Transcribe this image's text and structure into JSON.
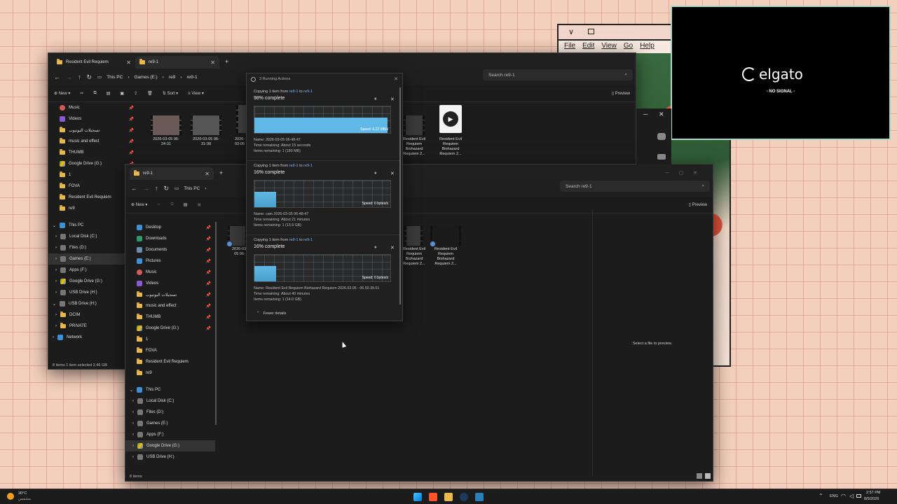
{
  "back_window": {
    "tabs": [
      {
        "label": "Resident Evil Requiem"
      },
      {
        "label": "re9-1"
      }
    ],
    "breadcrumb": [
      "This PC",
      "Games (E:)",
      "re9",
      "re9-1"
    ],
    "toolbar": {
      "new": "New",
      "sort": "Sort",
      "view": "View",
      "preview": "Preview"
    },
    "search_placeholder": "Search re9-1",
    "quick_access": [
      "Music",
      "Videos",
      "تسجيلات اليوتيوب",
      "music and effect",
      "THUMB",
      "Google Drive (G:)",
      "1",
      "FOVA",
      "Resident Evil Requiem",
      "re9"
    ],
    "this_pc": "This PC",
    "drives": [
      "Local Disk (C:)",
      "Files (D:)",
      "Games (E:)",
      "Apps (F:)",
      "Google Drive (G:)",
      "USB Drive (H:)"
    ],
    "usb_label": "USB Drive (H:)",
    "usb_children": [
      "DCIM",
      "PRIVATE"
    ],
    "network": "Network",
    "files": [
      {
        "name": "2026-03-05 06-24-31"
      },
      {
        "name": "2026-03-05 06-31-38"
      },
      {
        "name": "2026-03-05 06-4..."
      },
      {
        "name": "Resident Evil Requiem Biohazard Requiem 2..."
      },
      {
        "name": "Resident Evil Requiem Biohazard Requiem 2..."
      }
    ],
    "status": "8 items   1 item selected  2.46 GB"
  },
  "front_window": {
    "tab": "re9-1",
    "breadcrumb_left": "This PC",
    "breadcrumb_right": [
      "E9",
      "re9-1"
    ],
    "toolbar": {
      "new": "New",
      "preview": "Preview"
    },
    "search_placeholder": "Search re9-1",
    "quick_access": [
      "Desktop",
      "Downloads",
      "Documents",
      "Pictures",
      "Music",
      "Videos",
      "تسجيلات اليوتيوب",
      "music and effect",
      "THUMB",
      "Google Drive (G:)",
      "1",
      "FOVA",
      "Resident Evil Requiem",
      "re9"
    ],
    "this_pc": "This PC",
    "drives": [
      "Local Disk (C:)",
      "Files (D:)",
      "Games (E:)",
      "Apps (F:)",
      "Google Drive (G:)",
      "USB Drive (H:)"
    ],
    "files": [
      {
        "name": "2026-03-05 06-48-..."
      },
      {
        "name": "Resident Evil Requiem Biohazard Requiem 2..."
      },
      {
        "name": "Resident Evil Requiem Biohazard Requiem 2..."
      }
    ],
    "preview_text": "Select a file to preview.",
    "status": "8 items"
  },
  "copy_dialog": {
    "title": "3 Running Actions",
    "operations": [
      {
        "prefix": "Copying 1 item from",
        "src": "re9-1",
        "mid": "to",
        "dst": "re9-1",
        "percent": "98% complete",
        "progress": 0.98,
        "speed": "Speed: 6.22 MB/s",
        "name": "Name: 2026-03-05 06-48-47",
        "time": "Time remaining: About 15 seconds",
        "items": "Items remaining: 1 (180 MB)"
      },
      {
        "prefix": "Copying 1 item from",
        "src": "re9-1",
        "mid": "to",
        "dst": "re9-1",
        "percent": "16% complete",
        "progress": 0.16,
        "speed": "Speed: 0 bytes/s",
        "name": "Name: cam 2026-03-05 06-48-47",
        "time": "Time remaining: About 21 minutes",
        "items": "Items remaining: 1 (13.9 GB)"
      },
      {
        "prefix": "Copying 1 item from",
        "src": "re9-1",
        "mid": "to",
        "dst": "re9-1",
        "percent": "16% complete",
        "progress": 0.16,
        "speed": "Speed: 0 bytes/s",
        "name": "Name: Resident Evil Requiem Biohazard Requiem 2026.03.05 - 06.50.39.01",
        "time": "Time remaining: About 40 minutes",
        "items": "Items remaining: 1 (14.0 GB)"
      }
    ],
    "fewer_details": "Fewer details"
  },
  "old_window": {
    "menu": [
      "File",
      "Edit",
      "View",
      "Go",
      "Help"
    ]
  },
  "elgato": {
    "brand": "elgato",
    "status": "- NO SIGNAL -"
  },
  "taskbar": {
    "weather_temp": "30°C",
    "weather_desc": "مشمس",
    "lang": "ENG",
    "time": "2:57 PM",
    "date": "8/5/2026"
  },
  "colors": {
    "accent": "#5fb8e6",
    "folder": "#e8b84d",
    "link": "#7ab8ff"
  }
}
